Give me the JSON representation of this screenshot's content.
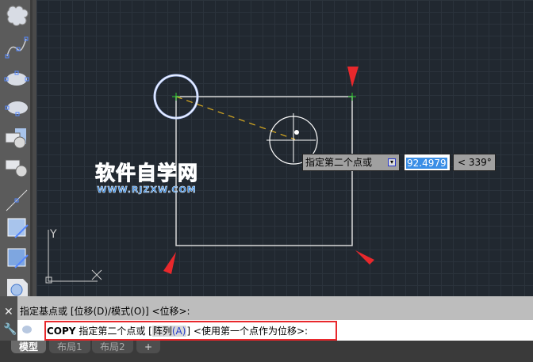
{
  "toolbar": {
    "tools": [
      "cloud-tool",
      "spline-tool",
      "ellipse-tool",
      "ellipse-arc-tool",
      "insert-block-tool",
      "create-block-tool",
      "point-tool",
      "hatch-tool",
      "gradient-tool",
      "region-tool"
    ]
  },
  "tooltip": {
    "prompt": "指定第二个点或",
    "length": "92.4979",
    "angle": "< 339°"
  },
  "watermark": {
    "title": "软件自学网",
    "url": "WWW.RJZXW.COM"
  },
  "ucs": {
    "x": "X",
    "y": "Y"
  },
  "command": {
    "history": "指定基点或 [位移(D)/模式(O)] <位移>:",
    "cmd": "COPY",
    "prompt": "指定第二个点或 [",
    "option": "阵列",
    "option_key": "(A)",
    "suffix": "] <使用第一个点作为位移>:"
  },
  "tabs": [
    "模型",
    "布局1",
    "布局2",
    "+"
  ],
  "colors": {
    "accent_red": "#e8282c",
    "selection_blue": "#3a8ee6"
  }
}
